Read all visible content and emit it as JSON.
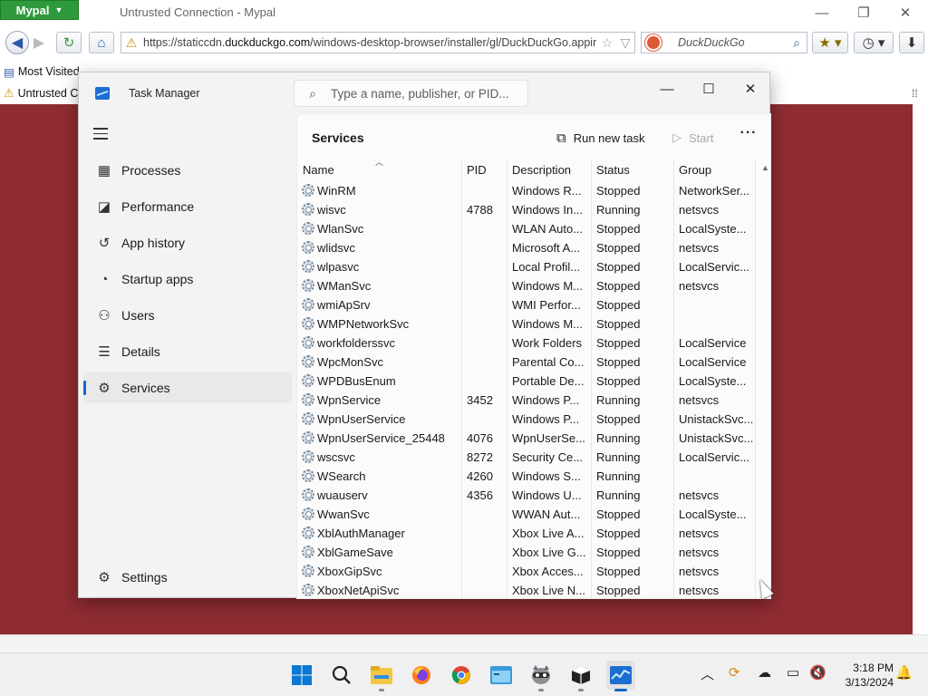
{
  "browser": {
    "app_button": "Mypal",
    "window_title": "Untrusted Connection - Mypal",
    "url_prefix": "https://staticcdn.",
    "url_domain": "duckduckgo.com",
    "url_path": "/windows-desktop-browser/installer/gl/DuckDuckGo.appir",
    "search_engine": "DuckDuckGo",
    "bookmark": "Most Visited",
    "tab": "Untrusted Connection",
    "content_color": "#8e2c32"
  },
  "task_manager": {
    "title": "Task Manager",
    "search_placeholder": "Type a name, publisher, or PID...",
    "nav": [
      {
        "label": "Processes",
        "icon": "processes-grid-icon"
      },
      {
        "label": "Performance",
        "icon": "performance-chart-icon"
      },
      {
        "label": "App history",
        "icon": "history-clock-icon"
      },
      {
        "label": "Startup apps",
        "icon": "startup-gauge-icon"
      },
      {
        "label": "Users",
        "icon": "users-icon"
      },
      {
        "label": "Details",
        "icon": "details-list-icon"
      },
      {
        "label": "Services",
        "icon": "services-puzzle-icon"
      }
    ],
    "active_nav": "Services",
    "settings_label": "Settings",
    "panel_title": "Services",
    "run_new_task": "Run new task",
    "start": "Start",
    "columns": {
      "name": "Name",
      "pid": "PID",
      "description": "Description",
      "status": "Status",
      "group": "Group"
    },
    "rows": [
      {
        "name": "WinRM",
        "pid": "",
        "description": "Windows R...",
        "status": "Stopped",
        "group": "NetworkSer..."
      },
      {
        "name": "wisvc",
        "pid": "4788",
        "description": "Windows In...",
        "status": "Running",
        "group": "netsvcs"
      },
      {
        "name": "WlanSvc",
        "pid": "",
        "description": "WLAN Auto...",
        "status": "Stopped",
        "group": "LocalSyste..."
      },
      {
        "name": "wlidsvc",
        "pid": "",
        "description": "Microsoft A...",
        "status": "Stopped",
        "group": "netsvcs"
      },
      {
        "name": "wlpasvc",
        "pid": "",
        "description": "Local Profil...",
        "status": "Stopped",
        "group": "LocalServic..."
      },
      {
        "name": "WManSvc",
        "pid": "",
        "description": "Windows M...",
        "status": "Stopped",
        "group": "netsvcs"
      },
      {
        "name": "wmiApSrv",
        "pid": "",
        "description": "WMI Perfor...",
        "status": "Stopped",
        "group": ""
      },
      {
        "name": "WMPNetworkSvc",
        "pid": "",
        "description": "Windows M...",
        "status": "Stopped",
        "group": ""
      },
      {
        "name": "workfolderssvc",
        "pid": "",
        "description": "Work Folders",
        "status": "Stopped",
        "group": "LocalService"
      },
      {
        "name": "WpcMonSvc",
        "pid": "",
        "description": "Parental Co...",
        "status": "Stopped",
        "group": "LocalService"
      },
      {
        "name": "WPDBusEnum",
        "pid": "",
        "description": "Portable De...",
        "status": "Stopped",
        "group": "LocalSyste..."
      },
      {
        "name": "WpnService",
        "pid": "3452",
        "description": "Windows P...",
        "status": "Running",
        "group": "netsvcs"
      },
      {
        "name": "WpnUserService",
        "pid": "",
        "description": "Windows P...",
        "status": "Stopped",
        "group": "UnistackSvc..."
      },
      {
        "name": "WpnUserService_25448",
        "pid": "4076",
        "description": "WpnUserSe...",
        "status": "Running",
        "group": "UnistackSvc..."
      },
      {
        "name": "wscsvc",
        "pid": "8272",
        "description": "Security Ce...",
        "status": "Running",
        "group": "LocalServic..."
      },
      {
        "name": "WSearch",
        "pid": "4260",
        "description": "Windows S...",
        "status": "Running",
        "group": ""
      },
      {
        "name": "wuauserv",
        "pid": "4356",
        "description": "Windows U...",
        "status": "Running",
        "group": "netsvcs"
      },
      {
        "name": "WwanSvc",
        "pid": "",
        "description": "WWAN Aut...",
        "status": "Stopped",
        "group": "LocalSyste..."
      },
      {
        "name": "XblAuthManager",
        "pid": "",
        "description": "Xbox Live A...",
        "status": "Stopped",
        "group": "netsvcs"
      },
      {
        "name": "XblGameSave",
        "pid": "",
        "description": "Xbox Live G...",
        "status": "Stopped",
        "group": "netsvcs"
      },
      {
        "name": "XboxGipSvc",
        "pid": "",
        "description": "Xbox Acces...",
        "status": "Stopped",
        "group": "netsvcs"
      },
      {
        "name": "XboxNetApiSvc",
        "pid": "",
        "description": "Xbox Live N...",
        "status": "Stopped",
        "group": "netsvcs"
      }
    ]
  },
  "taskbar": {
    "time": "3:18 PM",
    "date": "3/13/2024",
    "apps": [
      "windows-start-icon",
      "search-icon",
      "file-explorer-icon",
      "firefox-icon",
      "chrome-icon",
      "app-window-icon",
      "raccoon-app-icon",
      "package-icon",
      "task-manager-icon"
    ]
  }
}
